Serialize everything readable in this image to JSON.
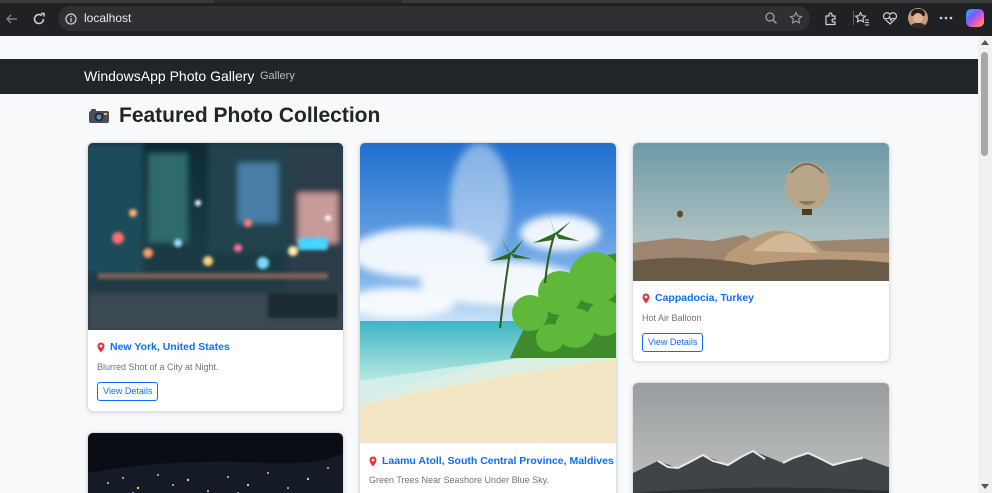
{
  "browser": {
    "url": "localhost"
  },
  "navbar": {
    "brand": "WindowsApp Photo Gallery",
    "links": [
      "Gallery"
    ]
  },
  "page": {
    "heading": "Featured Photo Collection"
  },
  "cards": [
    {
      "location": "New York, United States",
      "description": "Blurred Shot of a City at Night.",
      "button": "View Details"
    },
    {
      "location": "Laamu Atoll, South Central Province, Maldives",
      "description": "Green Trees Near Seashore Under Blue Sky.",
      "button": "View Details"
    },
    {
      "location": "Cappadocia, Turkey",
      "description": "Hot Air Balloon",
      "button": "View Details"
    }
  ],
  "colors": {
    "navbar": "#212529",
    "link": "#0d6efd",
    "pin": "#dc3545"
  }
}
